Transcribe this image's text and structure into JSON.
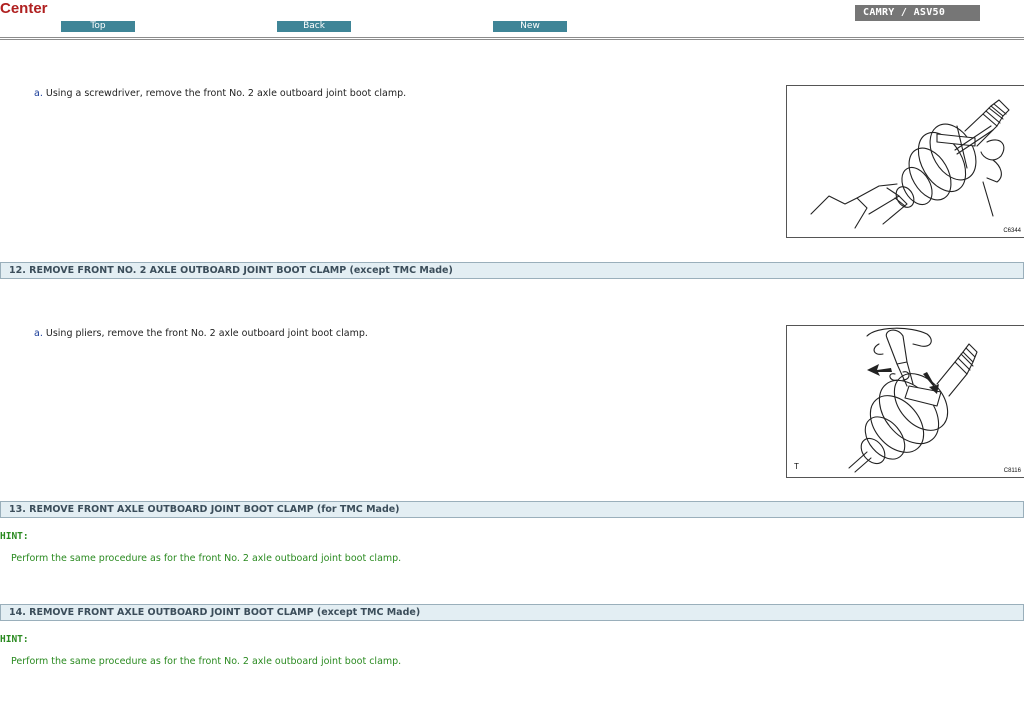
{
  "header": {
    "title": "Center",
    "nav": {
      "top": "Top",
      "back": "Back",
      "new": "New"
    },
    "vehicle": "CAMRY / ASV50"
  },
  "step_11": {
    "letter": "a.",
    "text": "Using a screwdriver, remove the front No. 2 axle outboard joint boot clamp.",
    "figure_code": "C6344"
  },
  "section_12": {
    "heading": "12. REMOVE FRONT NO. 2 AXLE OUTBOARD JOINT BOOT CLAMP (except TMC Made)",
    "letter": "a.",
    "text": "Using pliers, remove the front No. 2 axle outboard joint boot clamp.",
    "figure_code": "C8116",
    "figure_mark": "T"
  },
  "section_13": {
    "heading": "13. REMOVE FRONT AXLE OUTBOARD JOINT BOOT CLAMP (for TMC Made)",
    "hint_label": "HINT:",
    "hint_text": "Perform the same procedure as for the front No. 2 axle outboard joint boot clamp."
  },
  "section_14": {
    "heading": "14. REMOVE FRONT AXLE OUTBOARD JOINT BOOT CLAMP (except TMC Made)",
    "hint_label": "HINT:",
    "hint_text": "Perform the same procedure as for the front No. 2 axle outboard joint boot clamp."
  },
  "colors": {
    "title": "#b02020",
    "nav_button": "#3f8597",
    "badge": "#767676",
    "section_bar": "#e3eef3",
    "hint": "#2a8a20",
    "step_letter": "#1a3d9a"
  }
}
